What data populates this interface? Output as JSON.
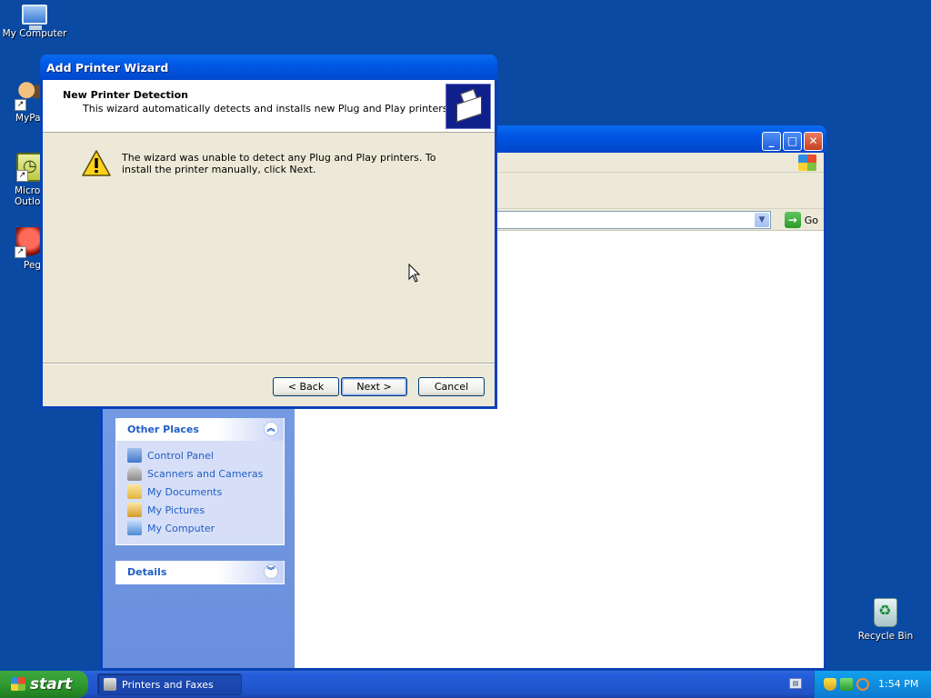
{
  "desktop": {
    "icons": [
      {
        "label": "My Computer"
      },
      {
        "label": "MyPa"
      },
      {
        "label": "Micros\nOutlo"
      },
      {
        "label": "Peg"
      },
      {
        "label": "Recycle Bin"
      }
    ]
  },
  "explorer": {
    "address_go": "Go",
    "other_places": {
      "title": "Other Places",
      "items": [
        {
          "label": "Control Panel",
          "icon": "control-panel-icon"
        },
        {
          "label": "Scanners and Cameras",
          "icon": "scanner-icon"
        },
        {
          "label": "My Documents",
          "icon": "folder-icon"
        },
        {
          "label": "My Pictures",
          "icon": "pictures-folder-icon"
        },
        {
          "label": "My Computer",
          "icon": "computer-icon"
        }
      ]
    },
    "details": {
      "title": "Details"
    }
  },
  "wizard": {
    "title": "Add Printer Wizard",
    "header_title": "New Printer Detection",
    "header_subtitle": "This wizard automatically detects and installs new Plug and Play printers.",
    "message": "The wizard was unable to detect any Plug and Play printers. To install the printer manually, click Next.",
    "buttons": {
      "back": "< Back",
      "next": "Next >",
      "cancel": "Cancel"
    }
  },
  "taskbar": {
    "start_label": "start",
    "task_item": "Printers and Faxes",
    "clock": "1:54 PM"
  },
  "colors": {
    "desktop": "#0a4aa3",
    "titlebar": "#0054e3",
    "dialog_face": "#ece9d8",
    "link": "#215dc6"
  }
}
